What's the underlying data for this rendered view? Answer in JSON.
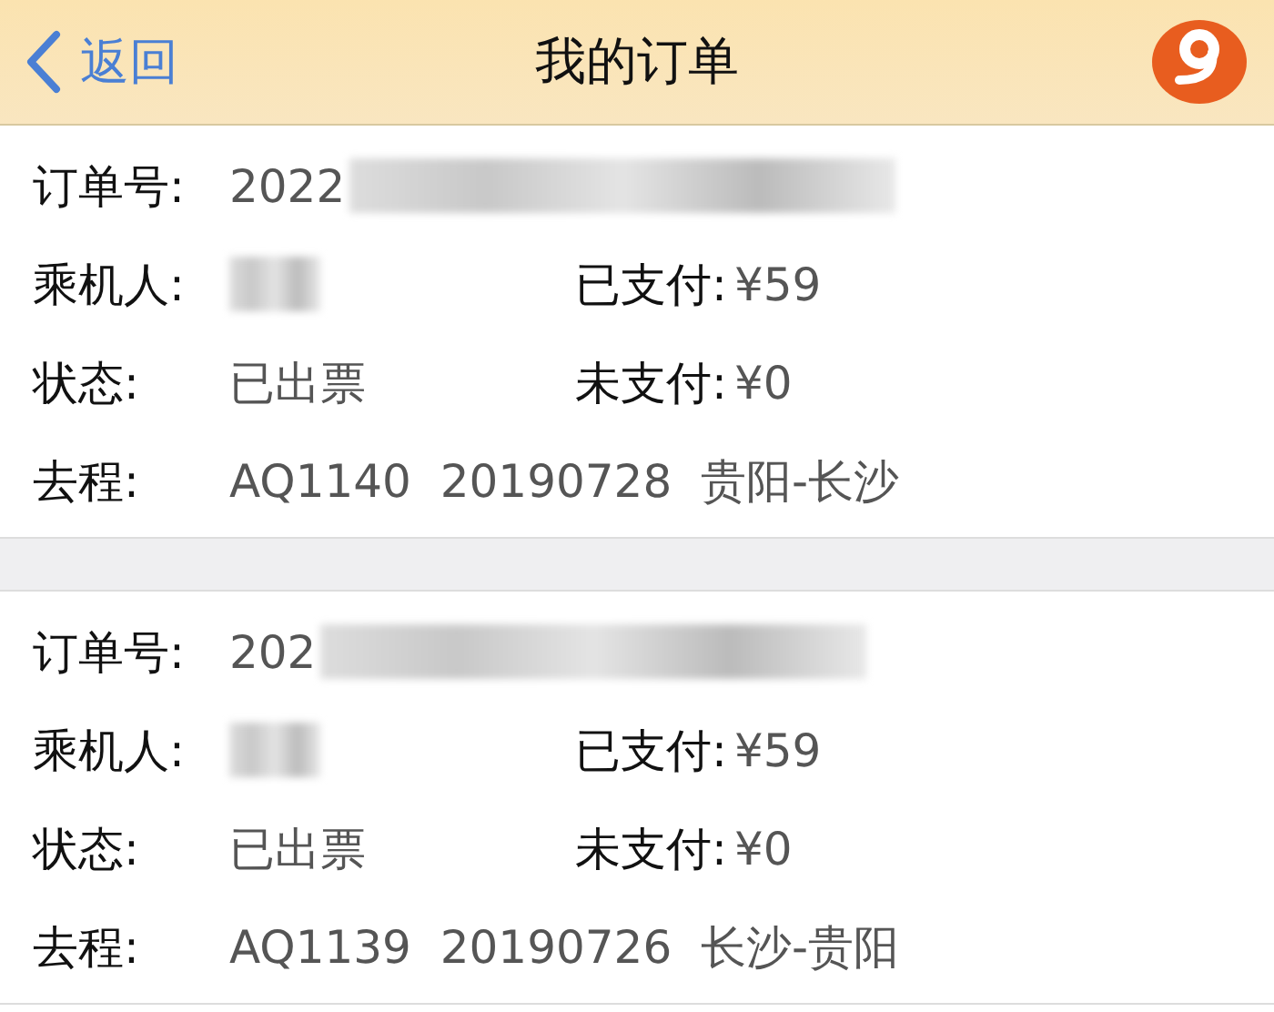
{
  "nav": {
    "back": "返回",
    "title": "我的订单"
  },
  "orders": [
    {
      "order_label": "订单号:",
      "order_no": "2022",
      "passenger_label": "乘机人:",
      "paid_label": "已支付:",
      "paid": "¥59",
      "status_label": "状态:",
      "status": "已出票",
      "unpaid_label": "未支付:",
      "unpaid": "¥0",
      "trip_label": "去程:",
      "trip": "AQ1140  20190728  贵阳-长沙"
    },
    {
      "order_label": "订单号:",
      "order_no": "202",
      "passenger_label": "乘机人:",
      "paid_label": "已支付:",
      "paid": "¥59",
      "status_label": "状态:",
      "status": "已出票",
      "unpaid_label": "未支付:",
      "unpaid": "¥0",
      "trip_label": "去程:",
      "trip": "AQ1139  20190726  长沙-贵阳"
    }
  ]
}
